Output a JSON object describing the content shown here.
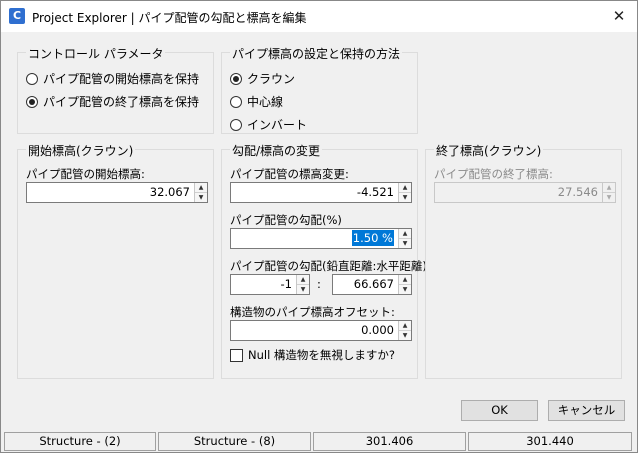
{
  "window": {
    "title": "Project Explorer | パイプ配管の勾配と標高を編集",
    "app_icon_glyph": "C",
    "close_glyph": "✕"
  },
  "control_params": {
    "title": "コントロール パラメータ",
    "options": [
      {
        "label": "パイプ配管の開始標高を保持",
        "checked": false
      },
      {
        "label": "パイプ配管の終了標高を保持",
        "checked": true
      }
    ]
  },
  "pipe_elev_method": {
    "title": "パイプ標高の設定と保持の方法",
    "options": [
      {
        "label": "クラウン",
        "checked": true
      },
      {
        "label": "中心線",
        "checked": false
      },
      {
        "label": "インバート",
        "checked": false
      }
    ]
  },
  "start_elev": {
    "title": "開始標高(クラウン)",
    "field_label": "パイプ配管の開始標高:",
    "value": "32.067"
  },
  "slope_change": {
    "title": "勾配/標高の変更",
    "elev_change_label": "パイプ配管の標高変更:",
    "elev_change_value": "-4.521",
    "slope_label": "パイプ配管の勾配(%)",
    "slope_value": "1.50 %",
    "ratio_label": "パイプ配管の勾配(鉛直距離:水平距離)",
    "ratio_vertical": "-1",
    "ratio_separator": ":",
    "ratio_horizontal": "66.667",
    "offset_label": "構造物のパイプ標高オフセット:",
    "offset_value": "0.000",
    "null_checkbox_label": "Null 構造物を無視しますか?",
    "null_checked": false
  },
  "end_elev": {
    "title": "終了標高(クラウン)",
    "field_label": "パイプ配管の終了標高:",
    "value": "27.546"
  },
  "buttons": {
    "ok": "OK",
    "cancel": "キャンセル"
  },
  "spin_glyphs": {
    "up": "▲",
    "down": "▼"
  },
  "status": [
    "Structure - (2)",
    "Structure - (8)",
    "301.406",
    "301.440"
  ]
}
